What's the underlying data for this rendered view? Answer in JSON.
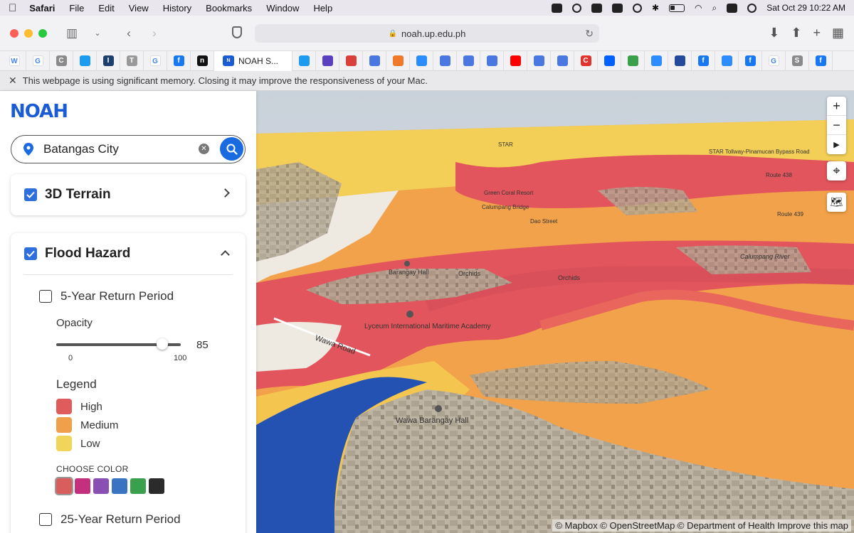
{
  "menubar": {
    "app": "Safari",
    "items": [
      "File",
      "Edit",
      "View",
      "History",
      "Bookmarks",
      "Window",
      "Help"
    ],
    "datetime": "Sat Oct 29  10:22 AM"
  },
  "browser": {
    "url": "noah.up.edu.ph",
    "active_tab": "NOAH S...",
    "notice": "This webpage is using significant memory. Closing it may improve the responsiveness of your Mac.",
    "favicons": [
      {
        "name": "wikipedia",
        "color": "#ffffff",
        "glyph": "W"
      },
      {
        "name": "google",
        "color": "#ffffff",
        "glyph": "G"
      },
      {
        "name": "site-c",
        "color": "#8a8a8a",
        "glyph": "C"
      },
      {
        "name": "twitter",
        "color": "#1d9bf0",
        "glyph": ""
      },
      {
        "name": "site-i",
        "color": "#1c3f6e",
        "glyph": "I"
      },
      {
        "name": "site-t",
        "color": "#999999",
        "glyph": "T"
      },
      {
        "name": "google",
        "color": "#ffffff",
        "glyph": "G"
      },
      {
        "name": "facebook",
        "color": "#1877f2",
        "glyph": "f"
      },
      {
        "name": "site-dark",
        "color": "#111111",
        "glyph": "n"
      }
    ],
    "favicons_after": [
      {
        "name": "twitter",
        "color": "#1d9bf0",
        "glyph": ""
      },
      {
        "name": "mail",
        "color": "#5a3fbf",
        "glyph": ""
      },
      {
        "name": "site-red",
        "color": "#d9403a",
        "glyph": ""
      },
      {
        "name": "docs",
        "color": "#4a78e0",
        "glyph": ""
      },
      {
        "name": "site-orange",
        "color": "#f07a2a",
        "glyph": ""
      },
      {
        "name": "zoom",
        "color": "#2d8cff",
        "glyph": ""
      },
      {
        "name": "docs",
        "color": "#4a78e0",
        "glyph": ""
      },
      {
        "name": "docs",
        "color": "#4a78e0",
        "glyph": ""
      },
      {
        "name": "docs",
        "color": "#4a78e0",
        "glyph": ""
      },
      {
        "name": "youtube",
        "color": "#ff0000",
        "glyph": ""
      },
      {
        "name": "docs",
        "color": "#4a78e0",
        "glyph": ""
      },
      {
        "name": "docs",
        "color": "#4a78e0",
        "glyph": ""
      },
      {
        "name": "site-c-red",
        "color": "#e0332c",
        "glyph": "C"
      },
      {
        "name": "dropbox",
        "color": "#0061ff",
        "glyph": ""
      },
      {
        "name": "recycle",
        "color": "#3aa04a",
        "glyph": ""
      },
      {
        "name": "zoom",
        "color": "#2d8cff",
        "glyph": ""
      },
      {
        "name": "inq",
        "color": "#244a9c",
        "glyph": ""
      },
      {
        "name": "facebook",
        "color": "#1877f2",
        "glyph": "f"
      },
      {
        "name": "zoom",
        "color": "#2d8cff",
        "glyph": ""
      },
      {
        "name": "facebook",
        "color": "#1877f2",
        "glyph": "f"
      },
      {
        "name": "google",
        "color": "#ffffff",
        "glyph": "G"
      },
      {
        "name": "site-s",
        "color": "#8a8a8a",
        "glyph": "S"
      },
      {
        "name": "facebook",
        "color": "#1877f2",
        "glyph": "f"
      }
    ]
  },
  "sidebar": {
    "logo": "NOAH",
    "search_value": "Batangas City",
    "terrain_card": {
      "title": "3D Terrain",
      "checked": true
    },
    "flood_card": {
      "title": "Flood Hazard",
      "checked": true,
      "period_5": "5-Year Return Period",
      "period_25": "25-Year Return Period",
      "opacity_label": "Opacity",
      "opacity_value": "85",
      "opacity_fraction": 0.85,
      "slider_min": "0",
      "slider_max": "100",
      "legend_title": "Legend",
      "legend": [
        {
          "label": "High",
          "color": "#e05c5c"
        },
        {
          "label": "Medium",
          "color": "#f0a04b"
        },
        {
          "label": "Low",
          "color": "#f1d45a"
        }
      ],
      "choose_color_label": "CHOOSE COLOR",
      "palette": [
        "#d85d5d",
        "#c2307e",
        "#8a4fb3",
        "#3a73c2",
        "#3ba04e",
        "#2b2b2b"
      ]
    }
  },
  "map": {
    "labels": {
      "star": "STAR",
      "star_tollway": "STAR Tollway-Pinamucan Bypass Road",
      "route438": "Route 438",
      "route439": "Route 439",
      "calumpang_bridge": "Calumpang Bridge",
      "dao_street": "Dao Street",
      "green_coral": "Green Coral Resort",
      "calumpang_river": "Calumpang River",
      "orchids1": "Orchids",
      "orchids2": "Orchids",
      "barangay_hall": "Barangay Hall",
      "lyceum": "Lyceum International Maritime Academy",
      "wawa_road": "Wawa Road",
      "wawa_hall": "Wawa Barangay Hall"
    },
    "attribution": "© Mapbox © OpenStreetMap © Department of Health Improve this map"
  }
}
